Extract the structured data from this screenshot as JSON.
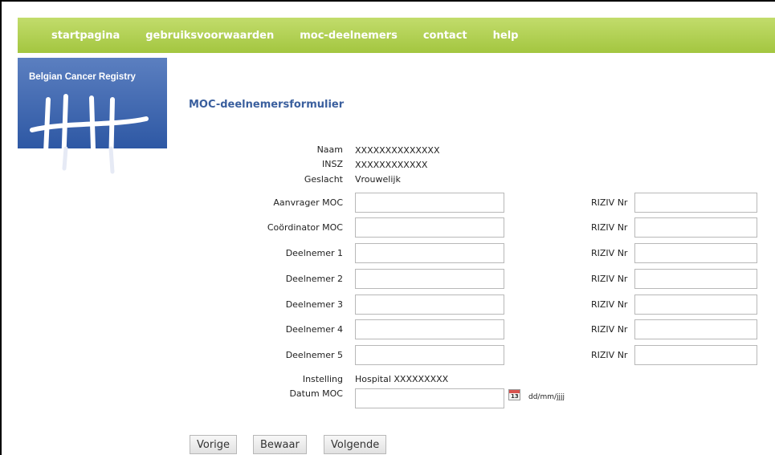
{
  "nav": [
    "startpagina",
    "gebruiksvoorwaarden",
    "moc-deelnemers",
    "contact",
    "help"
  ],
  "logo": {
    "title": "Belgian Cancer Registry"
  },
  "form": {
    "title": "MOC-deelnemersformulier",
    "patient": {
      "naam_label": "Naam",
      "naam_value": "XXXXXXXXXXXXXX",
      "insz_label": "INSZ",
      "insz_value": "XXXXXXXXXXXX",
      "geslacht_label": "Geslacht",
      "geslacht_value": "Vrouwelijk"
    },
    "participants": [
      {
        "label": "Aanvrager MOC",
        "value": "",
        "riziv_label": "RIZIV Nr",
        "riziv_value": ""
      },
      {
        "label": "Coördinator MOC",
        "value": "",
        "riziv_label": "RIZIV Nr",
        "riziv_value": ""
      },
      {
        "label": "Deelnemer 1",
        "value": "",
        "riziv_label": "RIZIV Nr",
        "riziv_value": ""
      },
      {
        "label": "Deelnemer 2",
        "value": "",
        "riziv_label": "RIZIV Nr",
        "riziv_value": ""
      },
      {
        "label": "Deelnemer 3",
        "value": "",
        "riziv_label": "RIZIV Nr",
        "riziv_value": ""
      },
      {
        "label": "Deelnemer 4",
        "value": "",
        "riziv_label": "RIZIV Nr",
        "riziv_value": ""
      },
      {
        "label": "Deelnemer 5",
        "value": "",
        "riziv_label": "RIZIV Nr",
        "riziv_value": ""
      }
    ],
    "instelling_label": "Instelling",
    "instelling_value": "Hospital XXXXXXXXX",
    "datum_label": "Datum MOC",
    "datum_value": "",
    "datum_hint": "dd/mm/jjjj",
    "calendar_icon_text": "13"
  },
  "buttons": {
    "prev": "Vorige",
    "save": "Bewaar",
    "next": "Volgende"
  },
  "colors": {
    "nav": "#a3c640",
    "logo": "#3a62aa",
    "title": "#3a5f9e"
  },
  "icons": {
    "calendar": "calendar-icon"
  }
}
